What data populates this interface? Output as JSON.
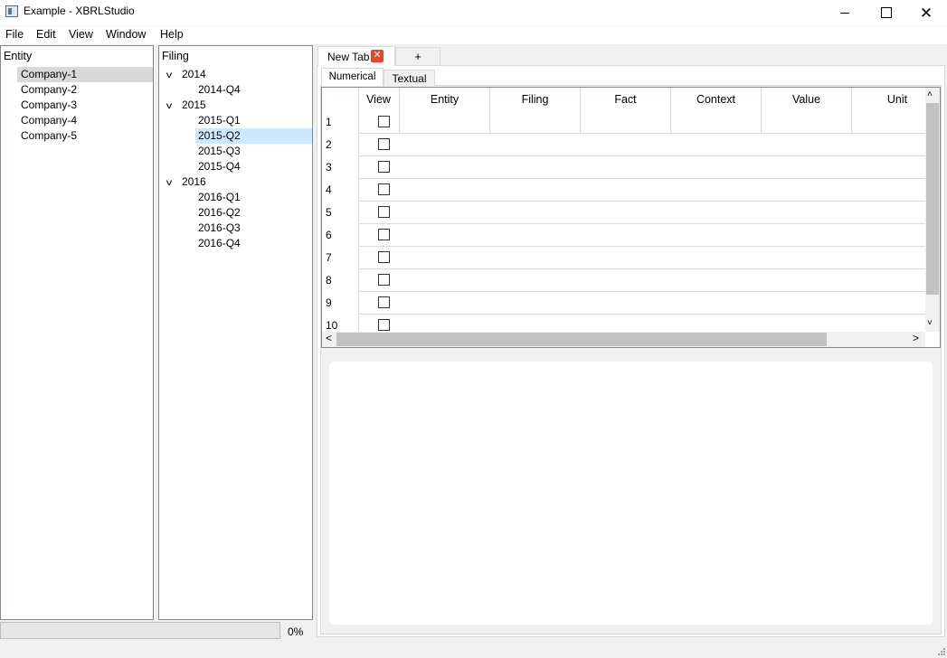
{
  "window": {
    "title": "Example - XBRLStudio",
    "icons": {
      "app": "app-window-icon",
      "minimize": "minimize-icon",
      "maximize": "maximize-icon",
      "close": "close-icon"
    },
    "close_glyph": "✕"
  },
  "menu": {
    "items": [
      "File",
      "Edit",
      "View",
      "Window",
      "Help"
    ]
  },
  "entity_panel": {
    "header": "Entity",
    "items": [
      "Company-1",
      "Company-2",
      "Company-3",
      "Company-4",
      "Company-5"
    ],
    "selected": "Company-1"
  },
  "filing_panel": {
    "header": "Filing",
    "expand_glyph": "v",
    "years": [
      {
        "label": "2014",
        "quarters": [
          "2014-Q4"
        ]
      },
      {
        "label": "2015",
        "quarters": [
          "2015-Q1",
          "2015-Q2",
          "2015-Q3",
          "2015-Q4"
        ]
      },
      {
        "label": "2016",
        "quarters": [
          "2016-Q1",
          "2016-Q2",
          "2016-Q3",
          "2016-Q4"
        ]
      }
    ],
    "selected": "2015-Q2"
  },
  "status": {
    "progress_text": "0%",
    "progress_fraction": 0
  },
  "tabs": {
    "outer": [
      {
        "label": "New Tab",
        "closable": true,
        "close_glyph": "✕"
      }
    ],
    "add_label": "+",
    "inner": [
      "Numerical",
      "Textual"
    ],
    "inner_selected": "Numerical"
  },
  "table": {
    "columns": [
      "View",
      "Entity",
      "Filing",
      "Fact",
      "Context",
      "Value",
      "Unit"
    ],
    "rows": [
      "1",
      "2",
      "3",
      "4",
      "5",
      "6",
      "7",
      "8",
      "9",
      "10"
    ],
    "checked": [
      false,
      false,
      false,
      false,
      false,
      false,
      false,
      false,
      false,
      false
    ]
  },
  "scrollbars": {
    "up": "˄",
    "down": "˅",
    "left": "<",
    "right": ">"
  },
  "colors": {
    "selection_blue": "#cce8ff",
    "selection_gray": "#d9d9d9",
    "close_tab": "#e04a2a"
  }
}
